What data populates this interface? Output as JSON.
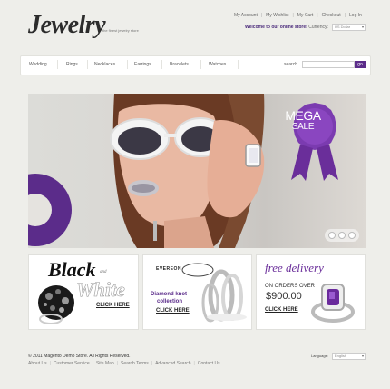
{
  "header": {
    "logo": "Jewelry",
    "tagline": "the finest jewelry store",
    "top_links": [
      "My Account",
      "My Wishlist",
      "My Cart",
      "Checkout",
      "Log In"
    ],
    "welcome": "Welcome to our online store!",
    "currency_label": "Currency:",
    "currency": "US Dollar"
  },
  "nav": {
    "items": [
      "Wedding",
      "Rings",
      "Necklaces",
      "Earrings",
      "Bracelets",
      "Watches"
    ],
    "search_label": "search",
    "search_placeholder": "",
    "search_button": "go"
  },
  "hero": {
    "badge_line1": "MEGA",
    "badge_line2": "SALE",
    "pager_count": 3
  },
  "promos": [
    {
      "title_a": "Black",
      "title_and": "and",
      "title_b": "White",
      "cta": "CLICK HERE"
    },
    {
      "brand": "EVEREON",
      "line1": "Diamond knot",
      "line2": "collection",
      "cta": "CLICK HERE"
    },
    {
      "title": "free delivery",
      "line1": "ON ORDERS OVER",
      "price": "$900.00",
      "cta": "CLICK HERE"
    }
  ],
  "footer": {
    "copyright": "© 2011 Magento Demo Store. All Rights Reserved.",
    "links": [
      "About Us",
      "Customer Service",
      "Site Map",
      "Search Terms",
      "Advanced Search",
      "Contact Us"
    ],
    "language_label": "Language:",
    "language": "English"
  },
  "colors": {
    "accent": "#5b2c8a",
    "background": "#eeeeea"
  }
}
